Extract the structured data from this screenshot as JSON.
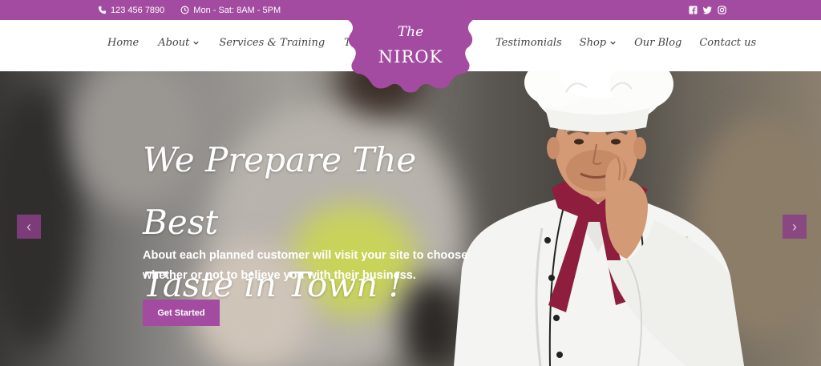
{
  "topbar": {
    "phone": "123 456 7890",
    "hours": "Mon - Sat: 8AM - 5PM",
    "icons": [
      "phone-icon",
      "clock-icon",
      "facebook-icon",
      "twitter-icon",
      "instagram-icon"
    ]
  },
  "logo": {
    "the": "The",
    "name": "NIROK"
  },
  "nav": {
    "left": [
      {
        "label": "Home"
      },
      {
        "label": "About"
      },
      {
        "label": "Services & Training"
      },
      {
        "label": "Team"
      }
    ],
    "right": [
      {
        "label": "Testimonials"
      },
      {
        "label": "Shop"
      },
      {
        "label": "Our Blog"
      },
      {
        "label": "Contact us"
      }
    ]
  },
  "hero": {
    "title_line1": "We Prepare The Best",
    "title_line2": "Taste in Town !",
    "subtitle_line1": "About each planned customer will visit your site to choose",
    "subtitle_line2": "whether or not to believe you with their business.",
    "cta_label": "Get Started",
    "prev_arrow": "‹",
    "next_arrow": "›"
  },
  "colors": {
    "accent": "#a34ba0",
    "accent_dark": "#8a3f88",
    "scarf": "#8e1d3e"
  }
}
